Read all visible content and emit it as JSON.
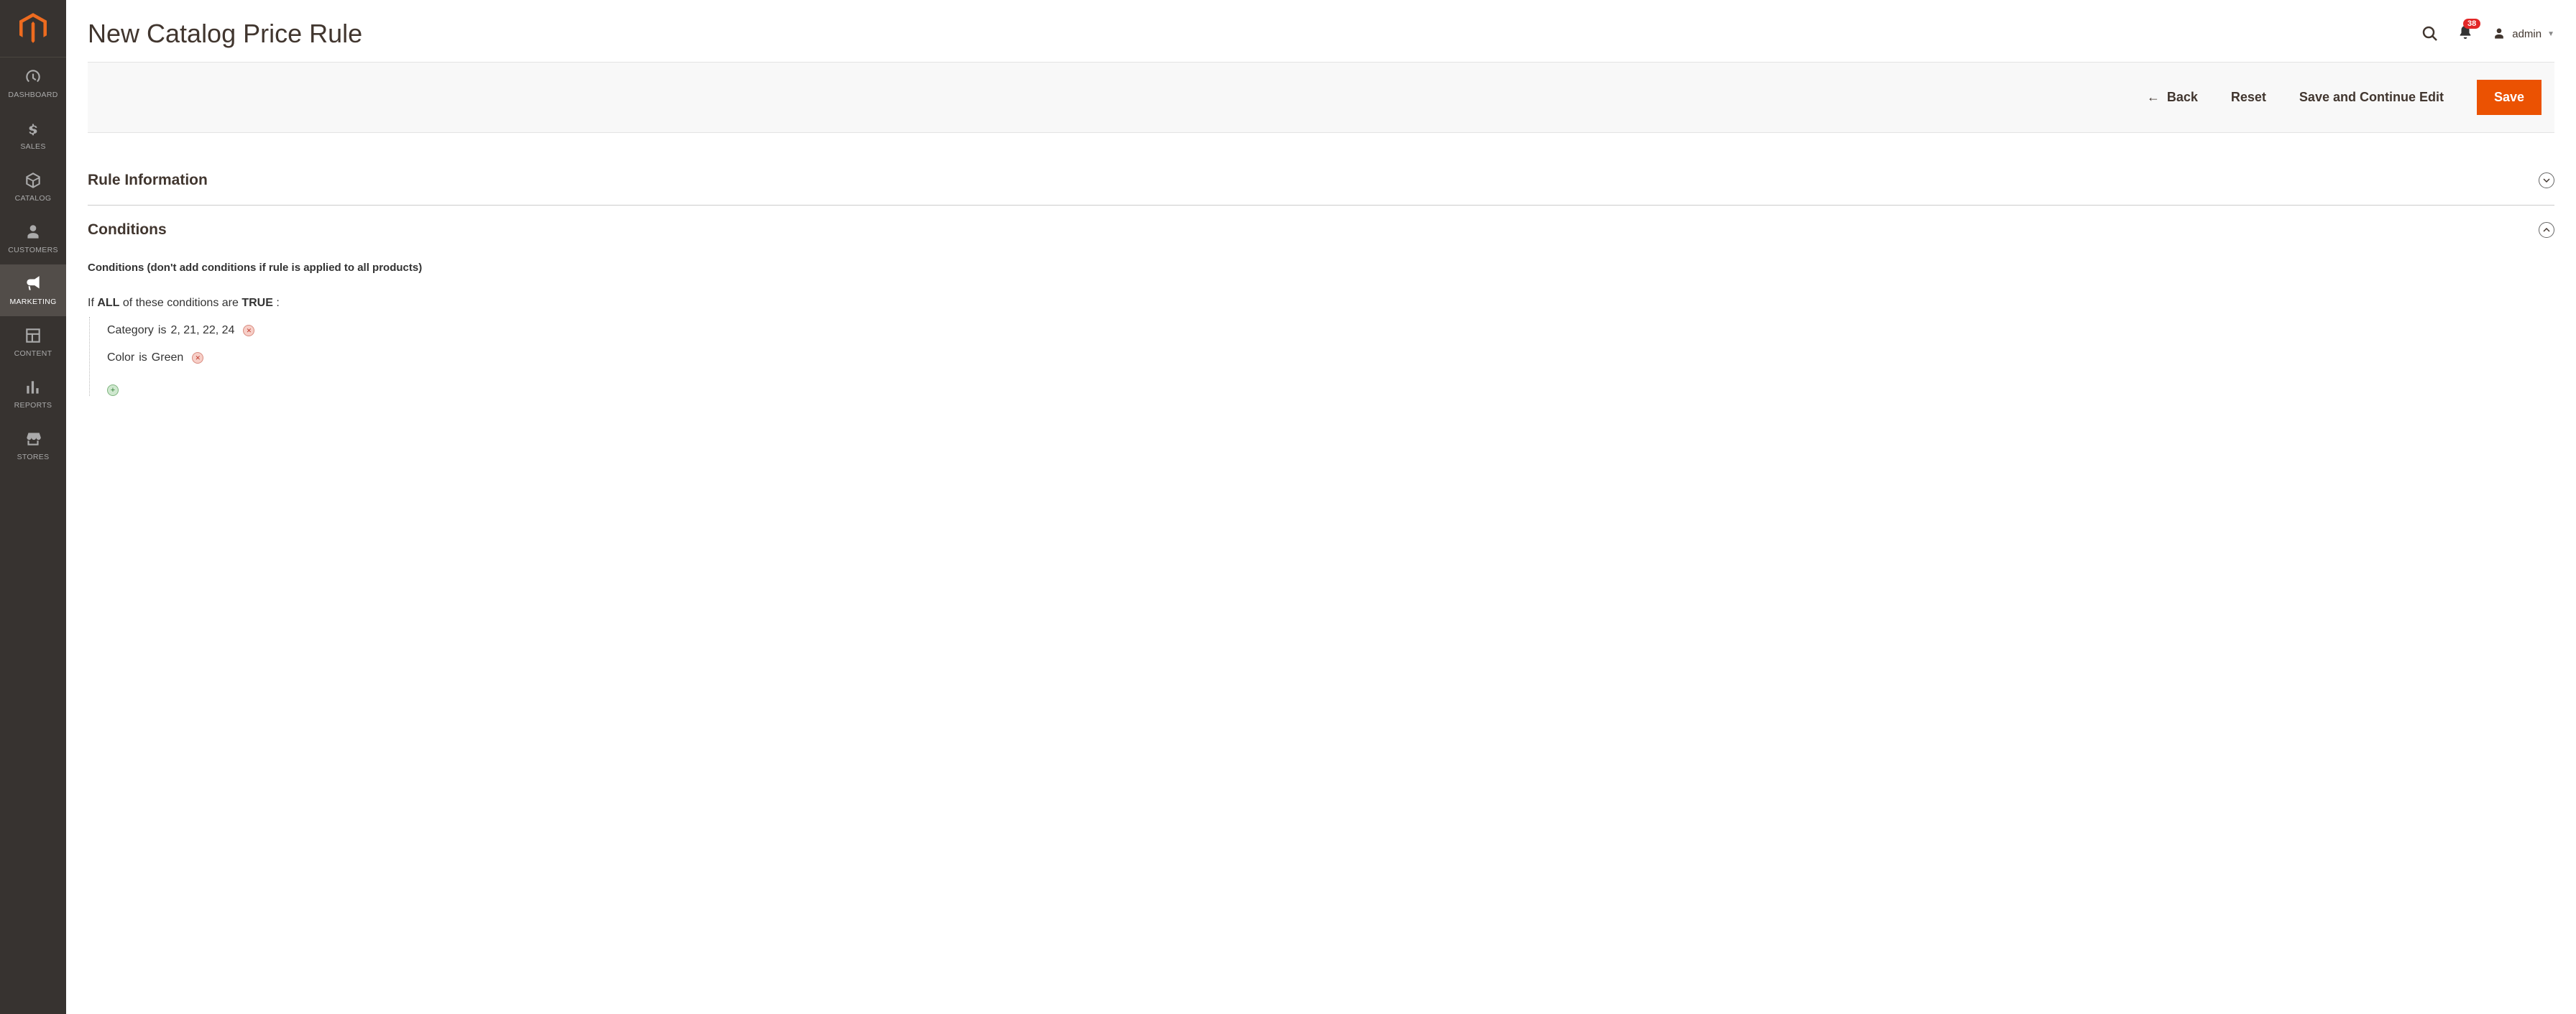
{
  "sidebar": {
    "items": [
      {
        "label": "DASHBOARD"
      },
      {
        "label": "SALES"
      },
      {
        "label": "CATALOG"
      },
      {
        "label": "CUSTOMERS"
      },
      {
        "label": "MARKETING"
      },
      {
        "label": "CONTENT"
      },
      {
        "label": "REPORTS"
      },
      {
        "label": "STORES"
      }
    ]
  },
  "header": {
    "title": "New Catalog Price Rule",
    "notification_count": "38",
    "user_label": "admin"
  },
  "actionbar": {
    "back": "Back",
    "reset": "Reset",
    "save_continue": "Save and Continue Edit",
    "save": "Save"
  },
  "sections": {
    "rule_info_title": "Rule Information",
    "conditions_title": "Conditions"
  },
  "conditions": {
    "note": "Conditions (don't add conditions if rule is applied to all products)",
    "sentence_prefix": "If ",
    "sentence_aggregator": "ALL",
    "sentence_mid": "  of these conditions are ",
    "sentence_value": "TRUE",
    "sentence_suffix": " :",
    "rows": [
      {
        "attr": "Category",
        "op": "is",
        "val": "2, 21, 22, 24"
      },
      {
        "attr": "Color",
        "op": "is",
        "val": "Green"
      }
    ]
  }
}
